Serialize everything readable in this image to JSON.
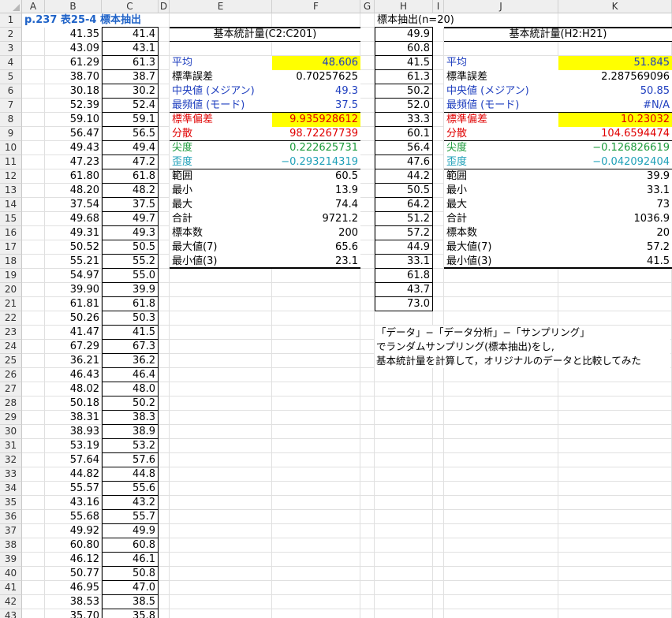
{
  "columns": [
    "A",
    "B",
    "C",
    "D",
    "E",
    "F",
    "G",
    "H",
    "I",
    "J",
    "K"
  ],
  "rows": [
    "1",
    "2",
    "3",
    "4",
    "5",
    "6",
    "7",
    "8",
    "9",
    "10",
    "11",
    "12",
    "13",
    "14",
    "15",
    "16",
    "17",
    "18",
    "19",
    "20",
    "21",
    "22",
    "23",
    "24",
    "25",
    "26",
    "27",
    "28",
    "29",
    "30",
    "31",
    "32",
    "33",
    "34",
    "35",
    "36",
    "37",
    "38",
    "39",
    "40",
    "41",
    "42",
    "43"
  ],
  "title": "p.237  表25-4  標本抽出",
  "colB": [
    "41.35",
    "43.09",
    "61.29",
    "38.70",
    "30.18",
    "52.39",
    "59.10",
    "56.47",
    "49.43",
    "47.23",
    "61.80",
    "48.20",
    "37.54",
    "49.68",
    "49.31",
    "50.52",
    "55.21",
    "54.97",
    "39.90",
    "61.81",
    "50.26",
    "41.47",
    "67.29",
    "36.21",
    "46.43",
    "48.02",
    "50.18",
    "38.31",
    "38.93",
    "53.19",
    "57.64",
    "44.82",
    "55.57",
    "43.16",
    "55.68",
    "49.92",
    "60.80",
    "46.12",
    "50.77",
    "46.95",
    "38.53",
    "35.70"
  ],
  "colC": [
    "41.4",
    "43.1",
    "61.3",
    "38.7",
    "30.2",
    "52.4",
    "59.1",
    "56.5",
    "49.4",
    "47.2",
    "61.8",
    "48.2",
    "37.5",
    "49.7",
    "49.3",
    "50.5",
    "55.2",
    "55.0",
    "39.9",
    "61.8",
    "50.3",
    "41.5",
    "67.3",
    "36.2",
    "46.4",
    "48.0",
    "50.2",
    "38.3",
    "38.9",
    "53.2",
    "57.6",
    "44.8",
    "55.6",
    "43.2",
    "55.7",
    "49.9",
    "60.8",
    "46.1",
    "50.8",
    "47.0",
    "38.5",
    "35.8"
  ],
  "stats1": {
    "header": "基本統計量(C2:C201)",
    "rows": [
      {
        "label": "平均",
        "value": "48.606"
      },
      {
        "label": "標準誤差",
        "value": "0.70257625"
      },
      {
        "label": "中央値 (メジアン)",
        "value": "49.3"
      },
      {
        "label": "最頻値 (モード)",
        "value": "37.5"
      },
      {
        "label": "標準偏差",
        "value": "9.935928612"
      },
      {
        "label": "分散",
        "value": "98.72267739"
      },
      {
        "label": "尖度",
        "value": "0.222625731"
      },
      {
        "label": "歪度",
        "value": "−0.293214319"
      },
      {
        "label": "範囲",
        "value": "60.5"
      },
      {
        "label": "最小",
        "value": "13.9"
      },
      {
        "label": "最大",
        "value": "74.4"
      },
      {
        "label": "合計",
        "value": "9721.2"
      },
      {
        "label": "標本数",
        "value": "200"
      },
      {
        "label": "最大値(7)",
        "value": "65.6"
      },
      {
        "label": "最小値(3)",
        "value": "23.1"
      }
    ]
  },
  "sampleHeader": "標本抽出(n=20)",
  "colH": [
    "49.9",
    "60.8",
    "41.5",
    "61.3",
    "50.2",
    "52.0",
    "33.3",
    "60.1",
    "56.4",
    "47.6",
    "44.2",
    "50.5",
    "64.2",
    "51.2",
    "57.2",
    "44.9",
    "33.1",
    "61.8",
    "43.7",
    "73.0"
  ],
  "stats2": {
    "header": "基本統計量(H2:H21)",
    "rows": [
      {
        "label": "平均",
        "value": "51.845"
      },
      {
        "label": "標準誤差",
        "value": "2.287569096"
      },
      {
        "label": "中央値 (メジアン)",
        "value": "50.85"
      },
      {
        "label": "最頻値 (モード)",
        "value": "#N/A"
      },
      {
        "label": "標準偏差",
        "value": "10.23032"
      },
      {
        "label": "分散",
        "value": "104.6594474"
      },
      {
        "label": "尖度",
        "value": "−0.126826619"
      },
      {
        "label": "歪度",
        "value": "−0.042092404"
      },
      {
        "label": "範囲",
        "value": "39.9"
      },
      {
        "label": "最小",
        "value": "33.1"
      },
      {
        "label": "最大",
        "value": "73"
      },
      {
        "label": "合計",
        "value": "1036.9"
      },
      {
        "label": "標本数",
        "value": "20"
      },
      {
        "label": "最大値(7)",
        "value": "57.2"
      },
      {
        "label": "最小値(3)",
        "value": "41.5"
      }
    ]
  },
  "notes": [
    "「データ」−「データ分析」−「サンプリング」",
    "でランダムサンプリング(標本抽出)をし,",
    "基本統計量を計算して，オリジナルのデータと比較してみた"
  ]
}
